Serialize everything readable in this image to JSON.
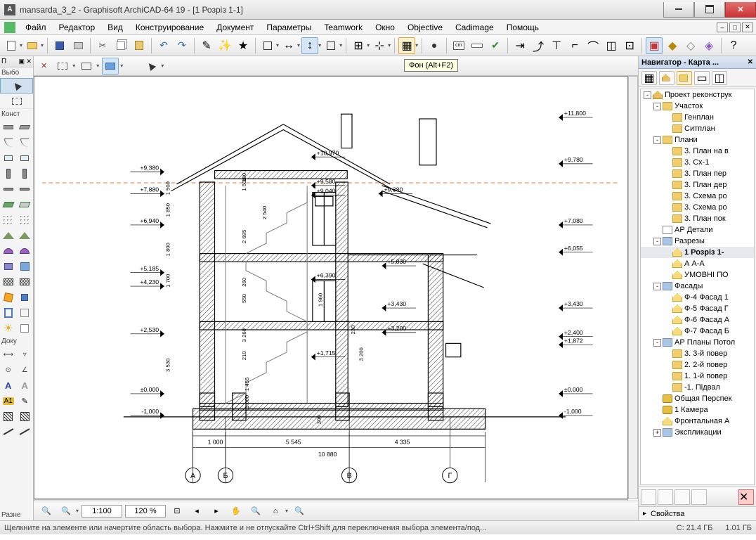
{
  "window_title": "mansarda_3_2 - Graphisoft ArchiCAD-64 19 - [1 Розріз 1-1]",
  "menu": [
    "Файл",
    "Редактор",
    "Вид",
    "Конструирование",
    "Документ",
    "Параметры",
    "Teamwork",
    "Окно",
    "Objective",
    "Cadimage",
    "Помощь"
  ],
  "tooltip": "Фон (Alt+F2)",
  "left_panel": {
    "header1": "П",
    "header2": "Выбо",
    "label_konstr": "Конст",
    "label_doku": "Доку",
    "label_razn": "Разне"
  },
  "bottom": {
    "scale": "1:100",
    "zoom": "120 %"
  },
  "navigator": {
    "title": "Навигатор - Карта ...",
    "props": "Свойства",
    "tree": [
      {
        "depth": 0,
        "toggle": "-",
        "icon": "house",
        "label": "Проект реконструк"
      },
      {
        "depth": 1,
        "toggle": "-",
        "icon": "folder",
        "label": "Участок"
      },
      {
        "depth": 2,
        "toggle": "",
        "icon": "folder",
        "label": "Генплан"
      },
      {
        "depth": 2,
        "toggle": "",
        "icon": "folder",
        "label": "Ситплан"
      },
      {
        "depth": 1,
        "toggle": "-",
        "icon": "folder",
        "label": "Плани"
      },
      {
        "depth": 2,
        "toggle": "",
        "icon": "folder",
        "label": "3. План на в"
      },
      {
        "depth": 2,
        "toggle": "",
        "icon": "folder",
        "label": "3. Сх-1"
      },
      {
        "depth": 2,
        "toggle": "",
        "icon": "folder",
        "label": "3. План пер"
      },
      {
        "depth": 2,
        "toggle": "",
        "icon": "folder",
        "label": "3. План дер"
      },
      {
        "depth": 2,
        "toggle": "",
        "icon": "folder",
        "label": "3. Схема ро"
      },
      {
        "depth": 2,
        "toggle": "",
        "icon": "folder",
        "label": "3. Схема ро"
      },
      {
        "depth": 2,
        "toggle": "",
        "icon": "folder",
        "label": "3. План пок"
      },
      {
        "depth": 1,
        "toggle": "",
        "icon": "plan",
        "label": "АР Детали"
      },
      {
        "depth": 1,
        "toggle": "-",
        "icon": "folder-blue",
        "label": "Разрезы"
      },
      {
        "depth": 2,
        "toggle": "",
        "icon": "house-yellow",
        "label": "1 Розріз 1-",
        "selected": true
      },
      {
        "depth": 2,
        "toggle": "",
        "icon": "house-yellow",
        "label": "А А-А"
      },
      {
        "depth": 2,
        "toggle": "",
        "icon": "house-yellow",
        "label": "УМОВНІ ПО"
      },
      {
        "depth": 1,
        "toggle": "-",
        "icon": "folder-blue",
        "label": "Фасады"
      },
      {
        "depth": 2,
        "toggle": "",
        "icon": "house-yellow",
        "label": "Ф-4 Фасад 1"
      },
      {
        "depth": 2,
        "toggle": "",
        "icon": "house-yellow",
        "label": "Ф-5 Фасад Г"
      },
      {
        "depth": 2,
        "toggle": "",
        "icon": "house-yellow",
        "label": "Ф-6 Фасад А"
      },
      {
        "depth": 2,
        "toggle": "",
        "icon": "house-yellow",
        "label": "Ф-7 Фасад Б"
      },
      {
        "depth": 1,
        "toggle": "-",
        "icon": "folder-blue",
        "label": "АР Планы Потол"
      },
      {
        "depth": 2,
        "toggle": "",
        "icon": "folder",
        "label": "3. 3-й повер"
      },
      {
        "depth": 2,
        "toggle": "",
        "icon": "folder",
        "label": "2. 2-й повер"
      },
      {
        "depth": 2,
        "toggle": "",
        "icon": "folder",
        "label": "1. 1-й повер"
      },
      {
        "depth": 2,
        "toggle": "",
        "icon": "folder",
        "label": "-1. Підвал"
      },
      {
        "depth": 1,
        "toggle": "",
        "icon": "camera",
        "label": "Общая Перспек"
      },
      {
        "depth": 1,
        "toggle": "",
        "icon": "camera",
        "label": "1 Камера"
      },
      {
        "depth": 1,
        "toggle": "",
        "icon": "house-yellow",
        "label": "Фронтальная А"
      },
      {
        "depth": 1,
        "toggle": "+",
        "icon": "folder-blue",
        "label": "Экспликации"
      }
    ]
  },
  "status": {
    "hint": "Щелкните на элементе или начертите область выбора. Нажмите и не отпускайте Ctrl+Shift для переключения выбора элемента/под...",
    "right1": "C: 21.4 ГБ",
    "right2": "1.01 ГБ"
  },
  "drawing": {
    "levels_left": [
      "+9,380",
      "+7,880",
      "+6,940",
      "+5,185",
      "+4,230",
      "+2,530",
      "±0,000",
      "-1,000"
    ],
    "levels_right": [
      "+11,800",
      "+9,780",
      "+9,380",
      "+7,080",
      "+6,055",
      "+5,830",
      "+3,430",
      "+3,430",
      "+3,200",
      "+2,400",
      "+1,872",
      "±0,000",
      "-1,000"
    ],
    "inner": [
      "+10,970",
      "+9,580",
      "+9,040",
      "+6,390",
      "+1,715"
    ],
    "dims_v": [
      "1 500",
      "1 850",
      "1 800",
      "1 700",
      "3 530",
      "1 500",
      "100",
      "2 540",
      "2 695",
      "260",
      "550",
      "1 960",
      "3 260",
      "230",
      "210",
      "3 200",
      "1 455",
      "1 000",
      "300"
    ],
    "dims_h": [
      "1 000",
      "5 545",
      "4 335",
      "10 880"
    ],
    "axes": [
      "А",
      "Б",
      "В",
      "Г"
    ]
  }
}
